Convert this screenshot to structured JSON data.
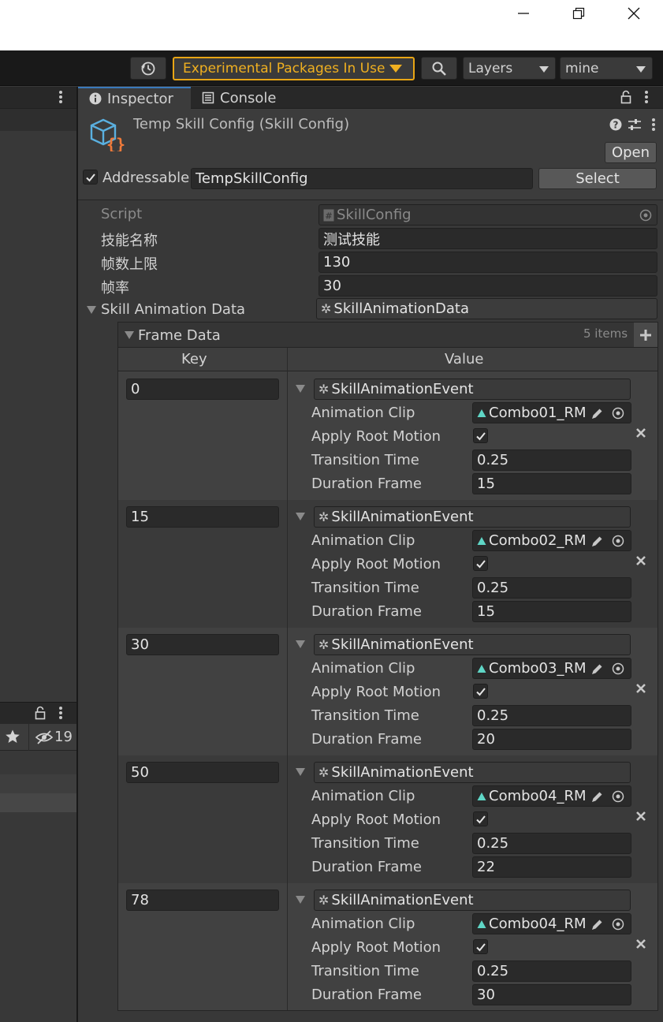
{
  "toolbar": {
    "experimental_label": "Experimental Packages In Use",
    "layers_label": "Layers",
    "layout_label": "mine"
  },
  "left_panel": {
    "hidden_count": "19"
  },
  "inspector": {
    "tabs": [
      {
        "label": "Inspector"
      },
      {
        "label": "Console"
      }
    ],
    "asset_title": "Temp Skill Config (Skill Config)",
    "open_label": "Open",
    "addressable_label": "Addressable",
    "address_value": "TempSkillConfig",
    "select_label": "Select",
    "fields": {
      "script_label": "Script",
      "script_value": "SkillConfig",
      "name_label": "技能名称",
      "name_value": "测试技能",
      "frame_limit_label": "帧数上限",
      "frame_limit_value": "130",
      "frame_rate_label": "帧率",
      "frame_rate_value": "30",
      "anim_data_label": "Skill Animation Data",
      "anim_data_value": "SkillAnimationData"
    },
    "frame_data": {
      "label": "Frame Data",
      "count": "5 items",
      "key_header": "Key",
      "value_header": "Value",
      "event_type": "SkillAnimationEvent",
      "clip_label": "Animation Clip",
      "root_motion_label": "Apply Root Motion",
      "transition_label": "Transition Time",
      "duration_label": "Duration Frame",
      "rows": [
        {
          "key": "0",
          "clip": "Combo01_RM",
          "root_motion": true,
          "transition": "0.25",
          "duration": "15"
        },
        {
          "key": "15",
          "clip": "Combo02_RM",
          "root_motion": true,
          "transition": "0.25",
          "duration": "15"
        },
        {
          "key": "30",
          "clip": "Combo03_RM",
          "root_motion": true,
          "transition": "0.25",
          "duration": "20"
        },
        {
          "key": "50",
          "clip": "Combo04_RM",
          "root_motion": true,
          "transition": "0.25",
          "duration": "22"
        },
        {
          "key": "78",
          "clip": "Combo04_RM",
          "root_motion": true,
          "transition": "0.25",
          "duration": "30"
        }
      ]
    }
  },
  "colors": {
    "accent_warning": "#f0b020",
    "tab_active_line": "#3a79bb",
    "asset_icon_blue": "#5ab0e0",
    "asset_icon_orange": "#f07a3a",
    "clip_icon": "#5fd6c6"
  }
}
